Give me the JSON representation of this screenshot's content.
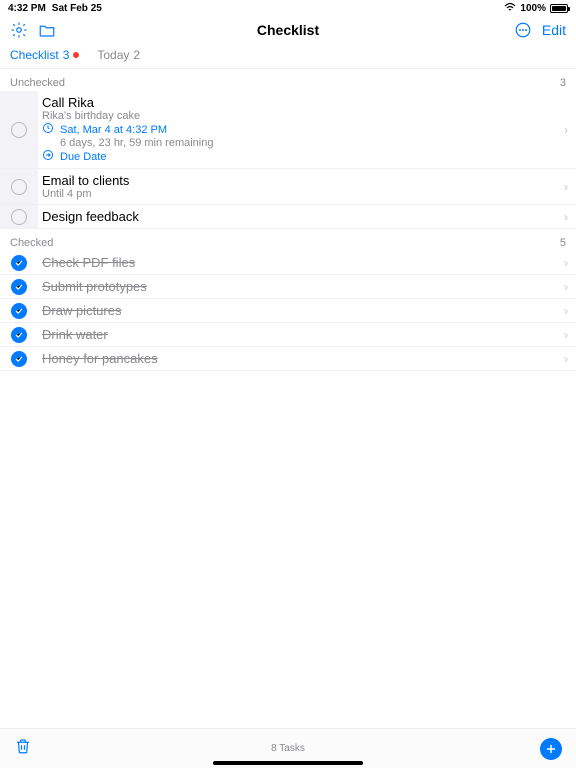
{
  "status": {
    "time": "4:32 PM",
    "date": "Sat Feb 25",
    "battery": "100%"
  },
  "nav": {
    "title": "Checklist",
    "edit": "Edit"
  },
  "segments": {
    "checklist": {
      "label": "Checklist",
      "count": "3"
    },
    "today": {
      "label": "Today",
      "count": "2"
    }
  },
  "sections": {
    "unchecked": {
      "title": "Unchecked",
      "count": "3"
    },
    "checked": {
      "title": "Checked",
      "count": "5"
    }
  },
  "unchecked": [
    {
      "title": "Call Rika",
      "subtitle": "Rika's birthday cake",
      "schedule": "Sat, Mar 4 at 4:32 PM",
      "remaining": "6 days, 23 hr, 59 min remaining",
      "due": "Due Date",
      "selected": true
    },
    {
      "title": "Email to clients",
      "subtitle": "Until 4 pm"
    },
    {
      "title": "Design feedback"
    }
  ],
  "checked": [
    {
      "title": "Check PDF files"
    },
    {
      "title": "Submit prototypes"
    },
    {
      "title": "Draw pictures"
    },
    {
      "title": "Drink water"
    },
    {
      "title": "Honey for pancakes"
    }
  ],
  "footer": {
    "count": "8 Tasks"
  }
}
